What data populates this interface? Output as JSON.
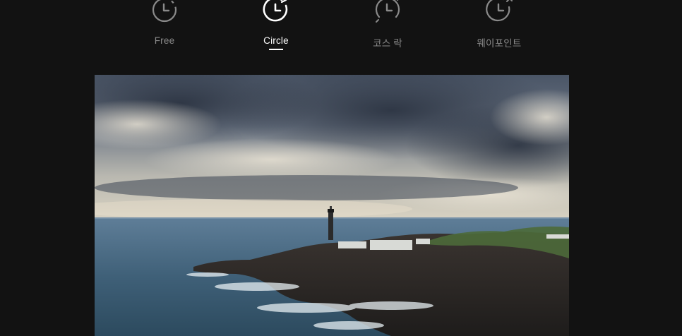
{
  "modes": [
    {
      "label": "Free",
      "icon": "timer-free-icon",
      "active": false
    },
    {
      "label": "Circle",
      "icon": "timer-circle-icon",
      "active": true
    },
    {
      "label": "코스 락",
      "icon": "timer-course-lock-icon",
      "active": false
    },
    {
      "label": "웨이포인트",
      "icon": "timer-waypoint-icon",
      "active": false
    }
  ],
  "colors": {
    "background": "#121212",
    "active_text": "#ffffff",
    "inactive_text": "#8a8a8a"
  },
  "preview": {
    "subject": "coastal lighthouse under cloudy sky"
  }
}
